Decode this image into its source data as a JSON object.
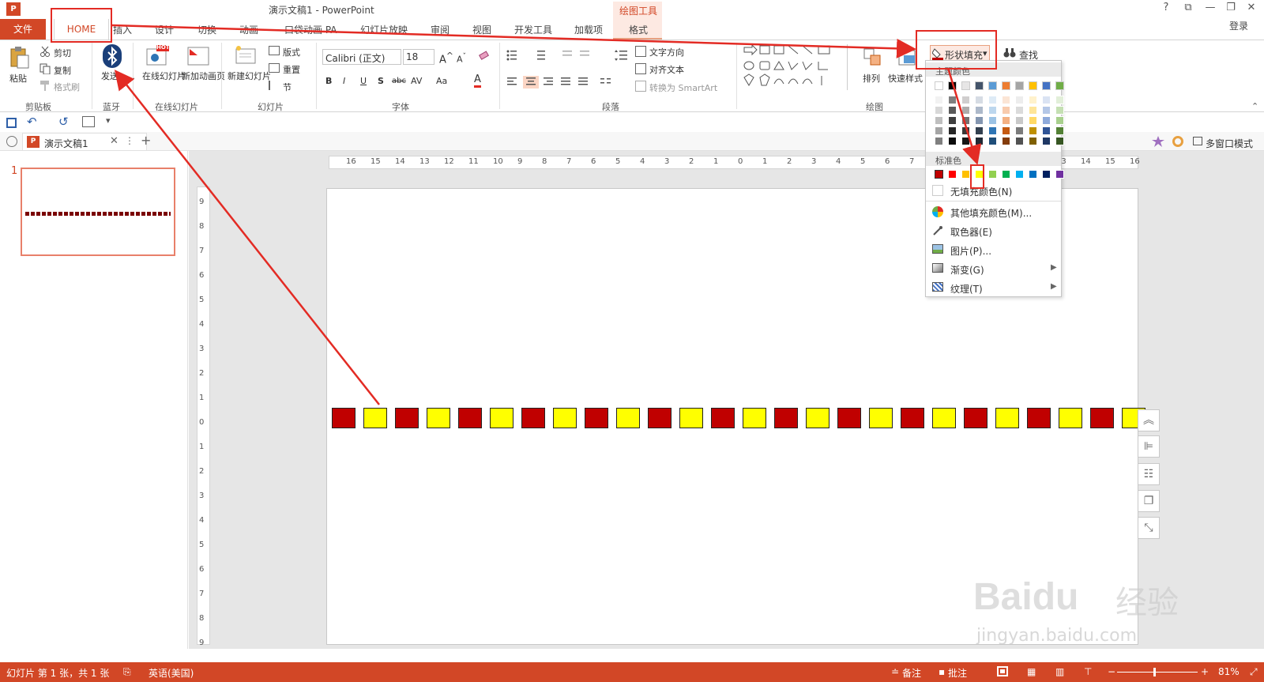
{
  "window": {
    "app_icon_letter": "P",
    "title": "演示文稿1 - PowerPoint",
    "controls": [
      "?",
      "⧉",
      "—",
      "❐",
      "✕"
    ]
  },
  "tabs": {
    "file": "文件",
    "home": "HOME",
    "items": [
      "插入",
      "设计",
      "切换",
      "动画",
      "口袋动画 PA",
      "幻灯片放映",
      "审阅",
      "视图",
      "开发工具",
      "加载项"
    ],
    "contextual_group": "绘图工具",
    "contextual_tab": "格式",
    "login": "登录"
  },
  "ribbon": {
    "clipboard": {
      "paste": "粘贴",
      "cut": "剪切",
      "copy": "复制",
      "format_painter": "格式刷",
      "group": "剪贴板"
    },
    "bluetooth": {
      "send": "发送......",
      "group": "蓝牙"
    },
    "online_slides": {
      "online": "在线幻灯片",
      "new_page": "新加动画页",
      "badge": "HOT",
      "group": "在线幻灯片"
    },
    "slides": {
      "new_slide": "新建幻灯片",
      "layout": "版式",
      "reset": "重置",
      "section": "节",
      "group": "幻灯片"
    },
    "font": {
      "font_name": "Calibri (正文)",
      "font_size": "18",
      "group": "字体",
      "bold": "B",
      "italic": "I",
      "underline": "U",
      "shadow": "S",
      "strike": "abc",
      "spacing": "AV",
      "case": "Aa",
      "color": "A"
    },
    "paragraph": {
      "text_direction": "文字方向",
      "align_text": "对齐文本",
      "smartart": "转换为 SmartArt",
      "group": "段落"
    },
    "drawing": {
      "arrange": "排列",
      "quick_styles": "快速样式",
      "shape_fill": "形状填充",
      "find": "查找",
      "group": "绘图"
    }
  },
  "fill_dropdown": {
    "theme_colors_label": "主题颜色",
    "standard_colors_label": "标准色",
    "theme_top": [
      "#ffffff",
      "#000000",
      "#e7e6e6",
      "#44546a",
      "#5b9bd5",
      "#ed7d31",
      "#a5a5a5",
      "#ffc000",
      "#4472c4",
      "#70ad47"
    ],
    "theme_shades": [
      [
        "#f2f2f2",
        "#7f7f7f",
        "#d0cece",
        "#d6dce4",
        "#deebf6",
        "#fbe5d5",
        "#ededed",
        "#fff2cc",
        "#dae3f3",
        "#e2efd9"
      ],
      [
        "#d8d8d8",
        "#595959",
        "#aeabab",
        "#adb9ca",
        "#bdd7ee",
        "#f8cbad",
        "#dbdbdb",
        "#fee599",
        "#b4c7e7",
        "#c5e0b3"
      ],
      [
        "#bfbfbf",
        "#3f3f3f",
        "#757070",
        "#8496b0",
        "#9cc3e5",
        "#f4b183",
        "#c9c9c9",
        "#ffd965",
        "#8eaadb",
        "#a8d08d"
      ],
      [
        "#a5a5a5",
        "#262626",
        "#3a3838",
        "#323f4f",
        "#2e75b5",
        "#c55a11",
        "#7b7b7b",
        "#bf9000",
        "#2f5496",
        "#538135"
      ],
      [
        "#7f7f7f",
        "#0c0c0c",
        "#171616",
        "#222a35",
        "#1f4e79",
        "#843c0b",
        "#525252",
        "#7f6000",
        "#1f3864",
        "#375623"
      ]
    ],
    "standard": [
      "#c00000",
      "#ff0000",
      "#ffc000",
      "#ffff00",
      "#92d050",
      "#00b050",
      "#00b0f0",
      "#0070c0",
      "#002060",
      "#7030a0"
    ],
    "no_fill": "无填充颜色(N)",
    "more_colors": "其他填充颜色(M)...",
    "eyedropper": "取色器(E)",
    "picture": "图片(P)...",
    "gradient": "渐变(G)",
    "texture": "纹理(T)"
  },
  "doc_tab": {
    "name": "演示文稿1",
    "multi_window": "多窗口模式"
  },
  "slide_panel": {
    "slide_number": "1"
  },
  "ruler": {
    "h_labels": [
      "16",
      "15",
      "14",
      "13",
      "12",
      "11",
      "10",
      "9",
      "8",
      "7",
      "6",
      "5",
      "4",
      "3",
      "2",
      "1",
      "0",
      "1",
      "2",
      "3",
      "4",
      "5",
      "6",
      "7",
      "8",
      "9",
      "10",
      "11",
      "12",
      "13",
      "14",
      "15",
      "16"
    ],
    "v_labels": [
      "9",
      "8",
      "7",
      "6",
      "5",
      "4",
      "3",
      "2",
      "1",
      "0",
      "1",
      "2",
      "3",
      "4",
      "5",
      "6",
      "7",
      "8",
      "9"
    ]
  },
  "squares": {
    "colors": [
      "#c00000",
      "#ffff00"
    ],
    "count": 26
  },
  "status": {
    "slide_info": "幻灯片 第 1 张，共 1 张",
    "language": "英语(美国)",
    "notes": "备注",
    "comments": "批注",
    "zoom": "81%"
  },
  "watermark": {
    "brand": "Bai",
    "brand2": "du",
    "cn": "经验",
    "url": "jingyan.baidu.com"
  }
}
